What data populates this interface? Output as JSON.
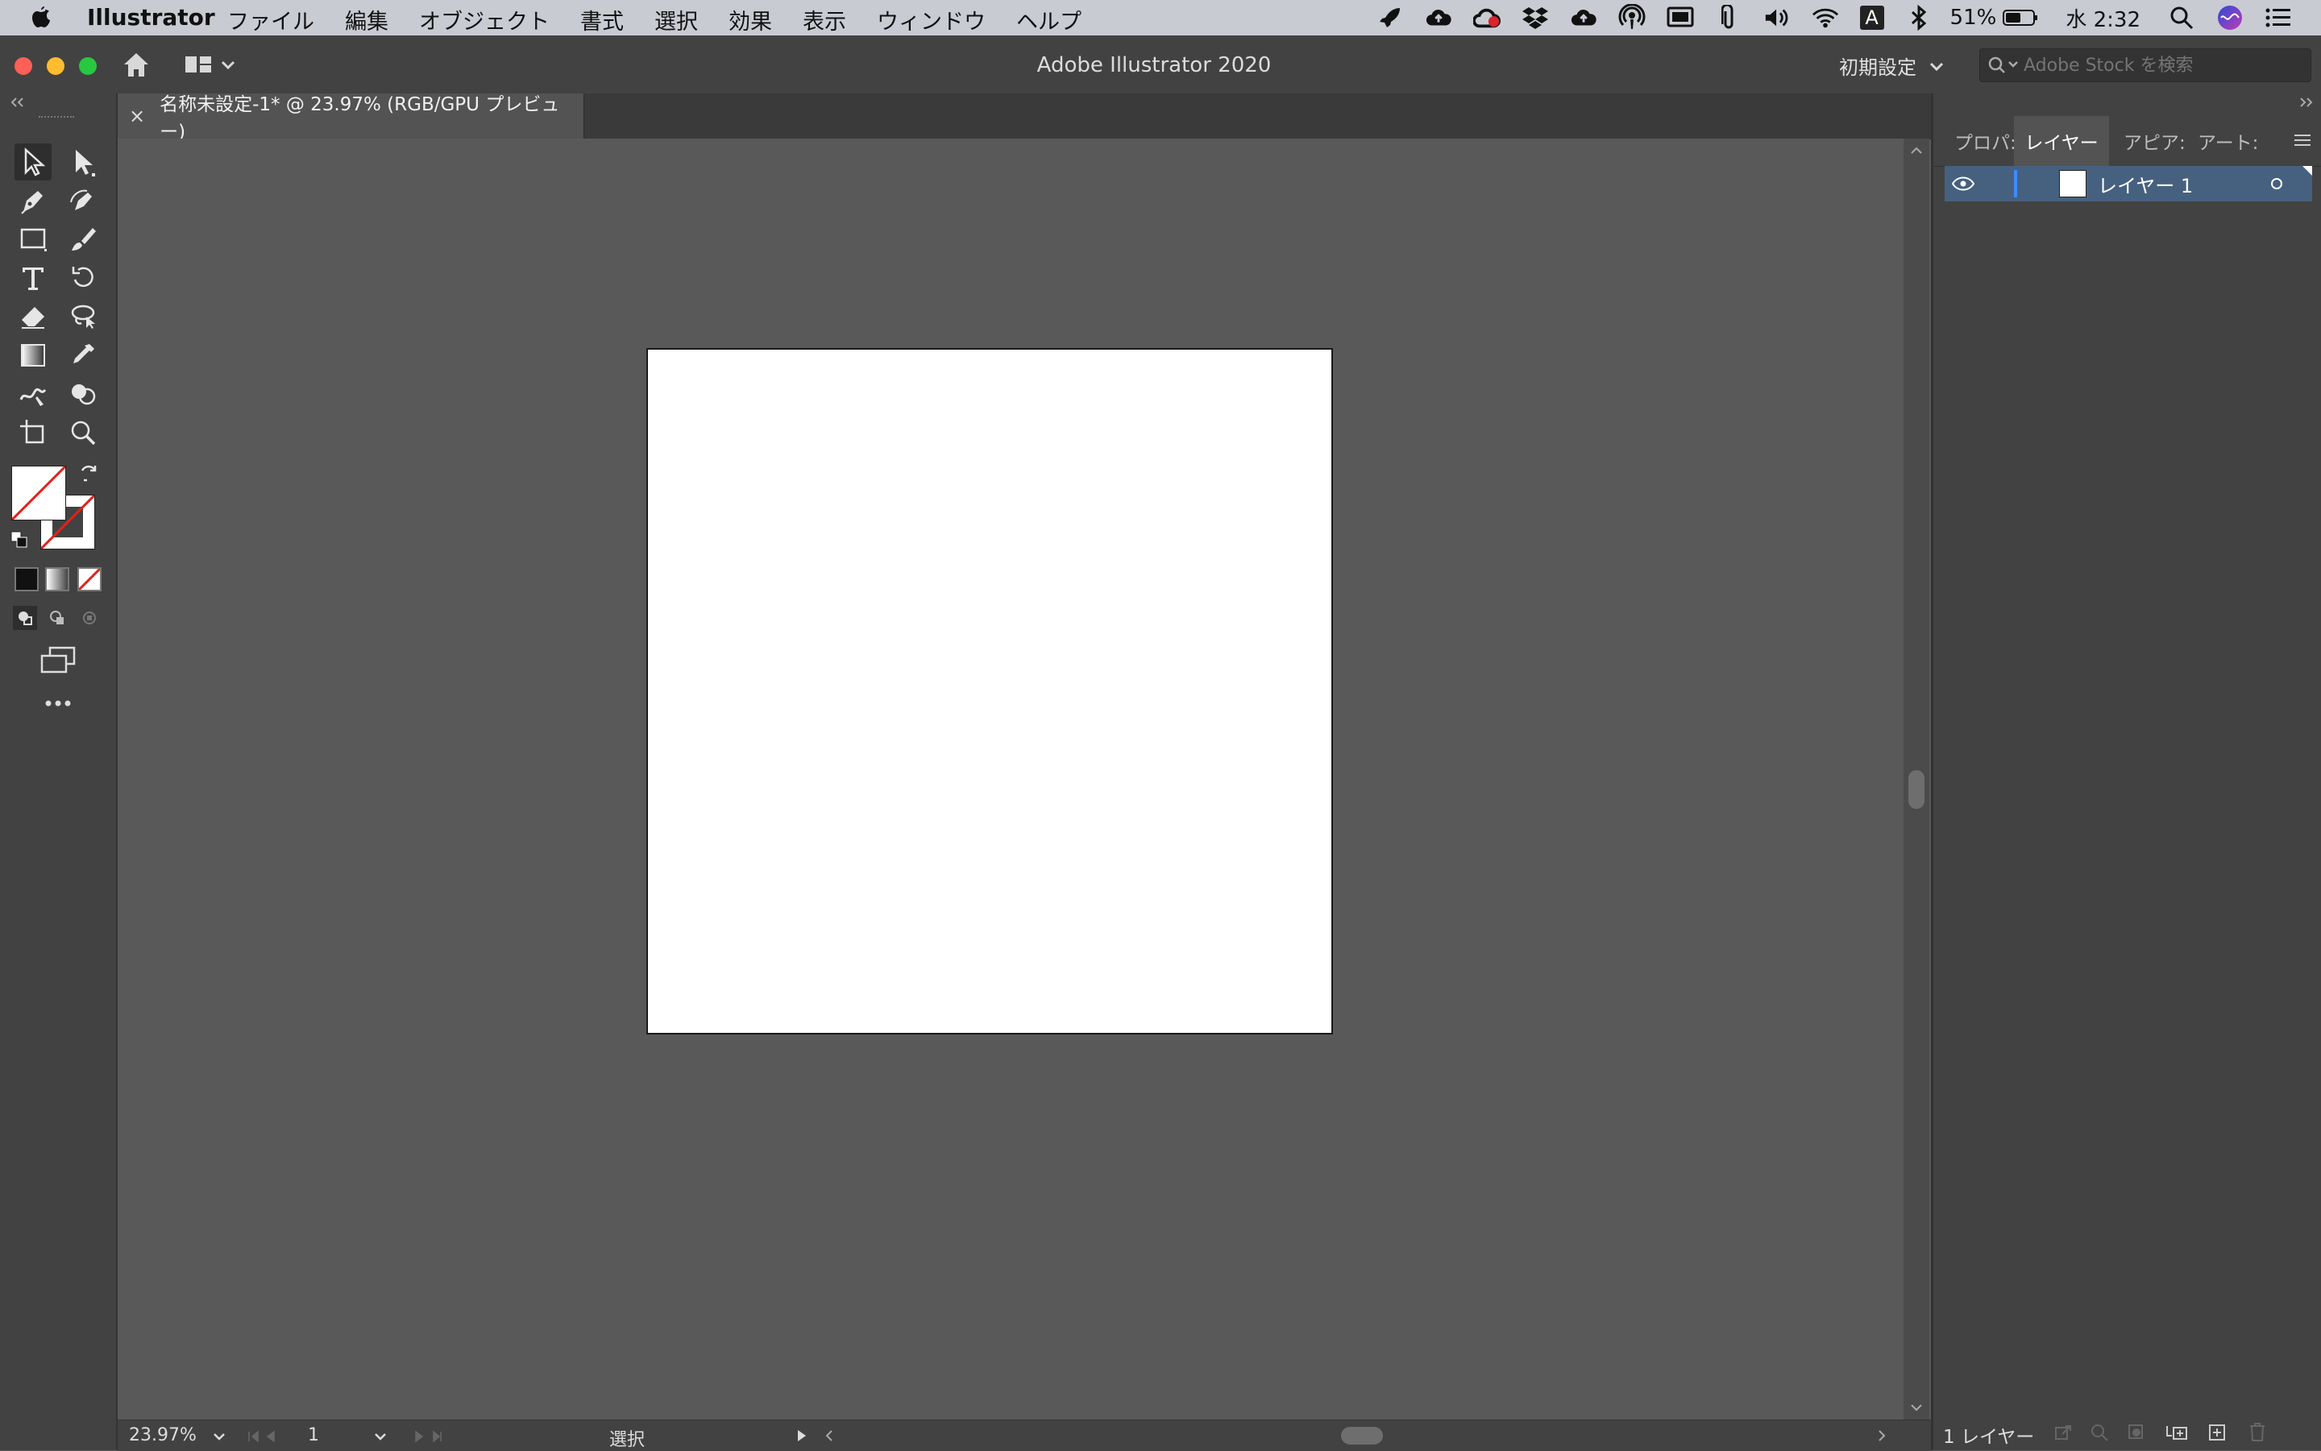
{
  "menubar": {
    "app_name": "Illustrator",
    "items": [
      "ファイル",
      "編集",
      "オブジェクト",
      "書式",
      "選択",
      "効果",
      "表示",
      "ウィンドウ",
      "ヘルプ"
    ],
    "battery": "51%",
    "input_badge": "A",
    "clock": "水 2:32"
  },
  "window": {
    "title": "Adobe Illustrator 2020",
    "workspace": "初期設定",
    "stock_search_placeholder": "Adobe Stock を検索"
  },
  "document": {
    "tab_label": "名称未設定-1* @ 23.97% (RGB/GPU プレビュー)",
    "close_glyph": "×"
  },
  "statusbar": {
    "zoom": "23.97%",
    "artboard_number": "1",
    "tool_name": "選択"
  },
  "panel": {
    "tabs": [
      "プロパ:",
      "レイヤー",
      "アピア:",
      "アート:"
    ],
    "active_tab": "レイヤー",
    "layers": [
      {
        "name": "レイヤー 1"
      }
    ],
    "footer_count": "1 レイヤー"
  },
  "colors": {
    "menubar_bg": "#c9cbd3",
    "ui_dark": "#424242",
    "canvas_bg": "#595959",
    "layer_selected": "#46617f",
    "layer_accent": "#3d8bff",
    "none_red": "#e0231a"
  },
  "icons": {
    "tools": [
      "selection",
      "direct-selection",
      "pen",
      "curvature",
      "rectangle",
      "paintbrush",
      "type",
      "rotate",
      "eraser",
      "lasso",
      "gradient",
      "eyedropper",
      "warp",
      "shape-builder",
      "artboard",
      "zoom"
    ]
  }
}
